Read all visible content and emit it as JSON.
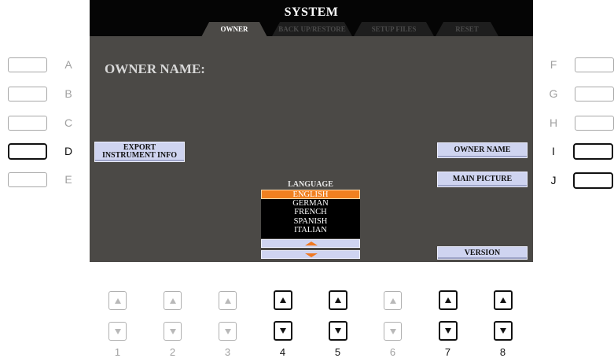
{
  "screen": {
    "title": "SYSTEM",
    "tabs": [
      {
        "label": "OWNER",
        "active": true
      },
      {
        "label": "BACK UP/RESTORE",
        "active": false
      },
      {
        "label": "SETUP FILES",
        "active": false
      },
      {
        "label": "RESET",
        "active": false
      }
    ],
    "owner_name_label": "OWNER NAME:",
    "export_button": "EXPORT\nINSTRUMENT INFO",
    "owner_name_button": "OWNER NAME",
    "main_picture_button": "MAIN PICTURE",
    "version_button": "VERSION",
    "language": {
      "label": "LANGUAGE",
      "options": [
        "ENGLISH",
        "GERMAN",
        "FRENCH",
        "SPANISH",
        "ITALIAN"
      ],
      "selected": "ENGLISH"
    },
    "colors": {
      "screen_bg": "#4b4946",
      "topbar_bg": "#050505",
      "button_bg": "#cfd4f0",
      "selection": "#f08020"
    }
  },
  "side_buttons": {
    "left": [
      {
        "letter": "A",
        "active": false
      },
      {
        "letter": "B",
        "active": false
      },
      {
        "letter": "C",
        "active": false
      },
      {
        "letter": "D",
        "active": true
      },
      {
        "letter": "E",
        "active": false
      }
    ],
    "right": [
      {
        "letter": "F",
        "active": false
      },
      {
        "letter": "G",
        "active": false
      },
      {
        "letter": "H",
        "active": false
      },
      {
        "letter": "I",
        "active": true
      },
      {
        "letter": "J",
        "active": true
      }
    ]
  },
  "bottom_buttons": [
    {
      "number": "1",
      "active": false
    },
    {
      "number": "2",
      "active": false
    },
    {
      "number": "3",
      "active": false
    },
    {
      "number": "4",
      "active": true
    },
    {
      "number": "5",
      "active": true
    },
    {
      "number": "6",
      "active": false
    },
    {
      "number": "7",
      "active": true
    },
    {
      "number": "8",
      "active": true
    }
  ]
}
